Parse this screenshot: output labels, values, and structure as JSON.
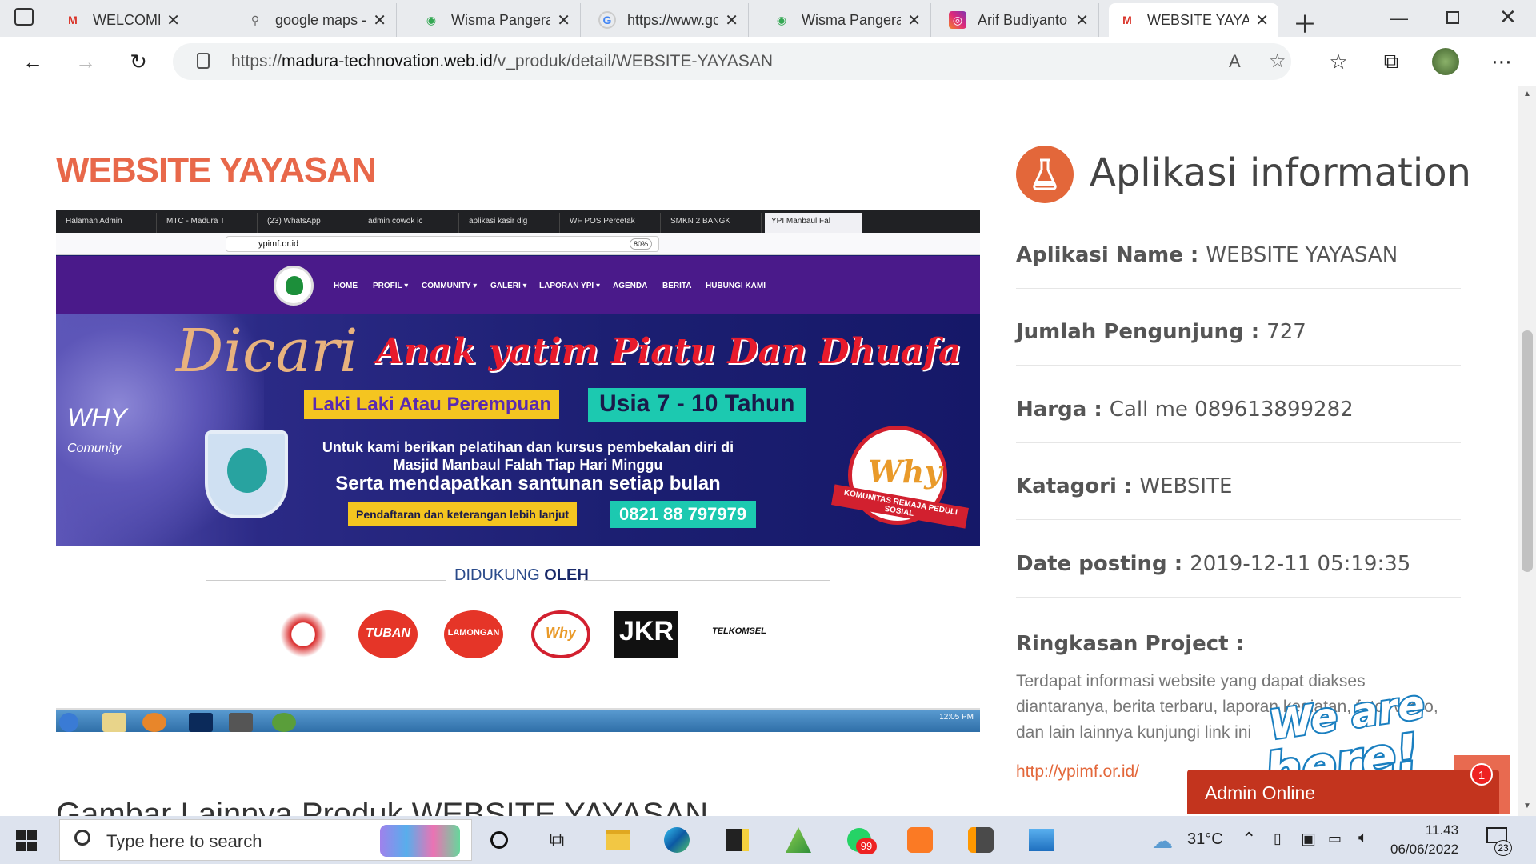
{
  "browser": {
    "tabs": [
      {
        "title": "WELCOME ON",
        "icon": "gmail-icon"
      },
      {
        "title": "google maps -",
        "icon": "search-icon"
      },
      {
        "title": "Wisma Pangera",
        "icon": "maps-pin-icon"
      },
      {
        "title": "https://www.go",
        "icon": "google-icon"
      },
      {
        "title": "Wisma Pangera",
        "icon": "maps-pin-icon"
      },
      {
        "title": "Arif Budiyanto",
        "icon": "instagram-icon"
      },
      {
        "title": "WEBSITE YAYA",
        "icon": "gmail-icon"
      }
    ],
    "url_prefix": "https://",
    "url_host": "madura-technovation.web.id",
    "url_path": "/v_produk/detail/WEBSITE-YAYASAN"
  },
  "page": {
    "title": "WEBSITE YAYASAN",
    "gallery_heading": "Gambar Lainnya Produk WEBSITE YAYASAN",
    "supported_by_prefix": "DIDUKUNG ",
    "supported_by_bold": "OLEH"
  },
  "screenshot": {
    "tabs": [
      "Halaman Admin",
      "MTC - Madura T",
      "(23) WhatsApp",
      "admin cowok ic",
      "aplikasi kasir dig",
      "WF POS Percetak",
      "SMKN 2 BANGK",
      "YPI Manbaul Fal"
    ],
    "url": "ypimf.or.id",
    "zoom": "80%",
    "nav": [
      "HOME",
      "PROFIL ▾",
      "COMMUNITY ▾",
      "GALERI ▾",
      "LAPORAN YPI ▾",
      "AGENDA",
      "BERITA",
      "HUBUNGI KAMI"
    ],
    "banner": {
      "dicari": "Dicari",
      "anak": "Anak yatim Piatu Dan Dhuafa",
      "laki": "Laki Laki",
      "atau": " Atau Perempuan",
      "usia": "Usia 7 - 10 Tahun",
      "line1": "Untuk kami berikan pelatihan dan kursus pembekalan diri di Masjid Manbaul Falah Tiap Hari Minggu",
      "line2": "Serta mendapatkan santunan setiap bulan",
      "daftar": "Pendaftaran dan keterangan lebih lanjut",
      "phone": "0821 88 797979",
      "why": "WHY",
      "comunity": "Comunity",
      "ribbon": "KOMUNITAS REMAJA PEDULI SOSIAL"
    },
    "sponsors": [
      "TUBAN",
      "LAMONGAN",
      "Why",
      "JKR",
      "TELKOMSEL"
    ],
    "taskbar_time": "12:05 PM"
  },
  "info": {
    "heading": "Aplikasi information",
    "rows": [
      {
        "label": "Aplikasi Name : ",
        "value": "WEBSITE YAYASAN"
      },
      {
        "label": "Jumlah Pengunjung : ",
        "value": "727"
      },
      {
        "label": "Harga : ",
        "value": "Call me 089613899282"
      },
      {
        "label": "Katagori : ",
        "value": "WEBSITE"
      },
      {
        "label": "Date posting : ",
        "value": "2019-12-11 05:19:35"
      }
    ],
    "ringkasan_label": "Ringkasan Project :",
    "ringkasan_text": "Terdapat informasi website yang dapat diakses diantaranya, berita terbaru, laporan kegiatan, foto, video, dan lain lainnya kunjungi link ini",
    "link": "http://ypimf.or.id/"
  },
  "chat": {
    "weare_line1": "We are",
    "weare_line2": "here!",
    "admin_online": "Admin Online",
    "badge": "1"
  },
  "taskbar": {
    "search_placeholder": "Type here to search",
    "temperature": "31°C",
    "time": "11.43",
    "date": "06/06/2022",
    "whatsapp_badge": "99",
    "notifications": "23"
  }
}
